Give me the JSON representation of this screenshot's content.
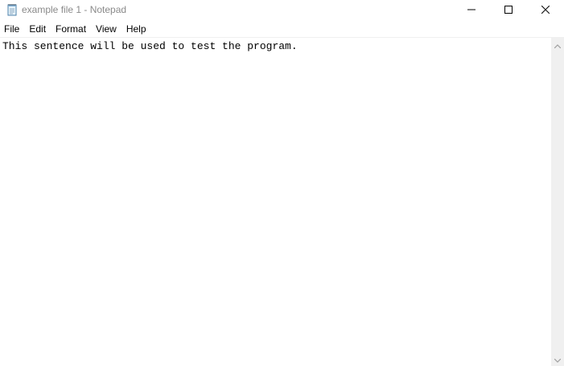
{
  "window": {
    "title": "example file 1 - Notepad",
    "icon": "notepad-icon",
    "controls": {
      "minimize": "minimize-icon",
      "maximize": "maximize-icon",
      "close": "close-icon"
    }
  },
  "menubar": {
    "items": [
      {
        "label": "File"
      },
      {
        "label": "Edit"
      },
      {
        "label": "Format"
      },
      {
        "label": "View"
      },
      {
        "label": "Help"
      }
    ]
  },
  "editor": {
    "content": "This sentence will be used to test the program."
  },
  "scrollbar": {
    "up_icon": "chevron-up-icon",
    "down_icon": "chevron-down-icon"
  }
}
